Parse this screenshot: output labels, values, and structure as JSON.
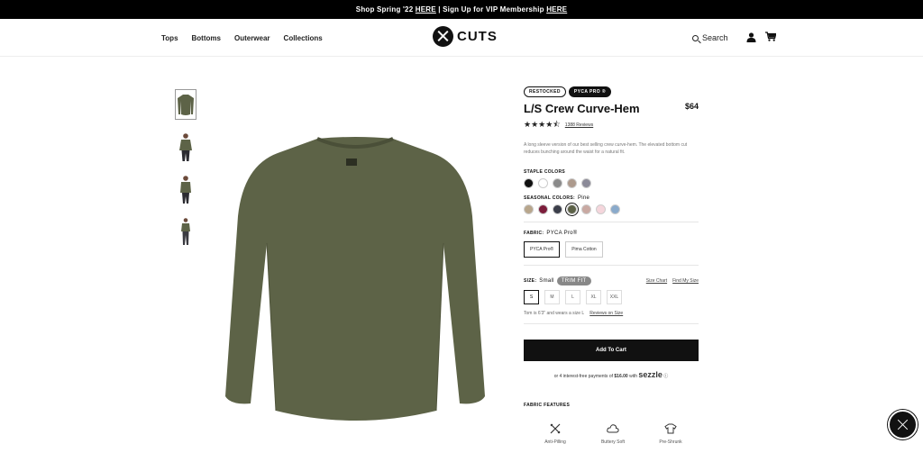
{
  "promo": {
    "prefix": "Shop Spring '22",
    "link1": "HERE",
    "middle": "| Sign Up for VIP Membership",
    "link2": "HERE"
  },
  "nav": {
    "items": [
      "Tops",
      "Bottoms",
      "Outerwear",
      "Collections"
    ]
  },
  "brand": {
    "name": "CUTS"
  },
  "header": {
    "search_label": "Search"
  },
  "product": {
    "badges": [
      "RESTOCKED",
      "PYCA PRO ®"
    ],
    "title": "L/S Crew Curve-Hem",
    "price": "$64",
    "rating": 4.5,
    "stars": "★★★★⯪",
    "reviews": "1388 Reviews",
    "description": "A long sleeve version of our best selling crew curve-hem. The elevated bottom cut reduces bunching around the waist for a natural fit.",
    "color_main": "#5d6347"
  },
  "staple": {
    "label": "STAPLE COLORS",
    "colors": [
      "#111111",
      "#ffffff",
      "#8a8a8a",
      "#ad9a8d",
      "#8b8a98"
    ]
  },
  "seasonal": {
    "label": "SEASONAL COLORS:",
    "selected": "Pine",
    "colors": [
      "#b8a68c",
      "#7c1d3b",
      "#3b3e4a",
      "#5c6147",
      "#c9a9a2",
      "#f5d6dc",
      "#8aaacb"
    ]
  },
  "fabric": {
    "label": "FABRIC:",
    "selected": "PYCA Pro®",
    "options": [
      "PYCA Pro®",
      "Pima Cotton"
    ]
  },
  "size": {
    "label": "SIZE:",
    "selected": "Small",
    "fit_badge": "TRIM FIT",
    "chart_link": "Size Chart",
    "find_link": "Find My Size",
    "options": [
      "S",
      "M",
      "L",
      "XL",
      "XXL"
    ],
    "fit_note": "Tom is 6'3\" and wears a size L",
    "fit_reviews": "Reviews on Size"
  },
  "cart": {
    "label": "Add To Cart"
  },
  "sezzle": {
    "prefix": "or 4 interest-free payments of",
    "amount": "$16.00",
    "with": "with",
    "brand": "sezzle",
    "info": "ⓘ"
  },
  "features": {
    "label": "FABRIC FEATURES",
    "items": [
      "Anti-Pilling",
      "Buttery Soft",
      "Pre-Shrunk"
    ]
  }
}
